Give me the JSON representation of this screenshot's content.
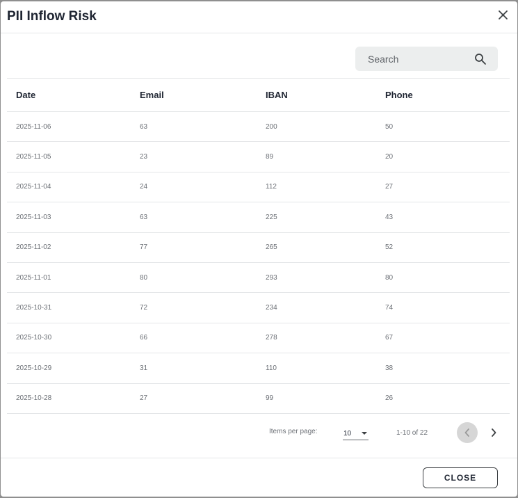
{
  "dialog": {
    "title": "PII Inflow Risk",
    "close_icon": "close-icon"
  },
  "search": {
    "placeholder": "Search",
    "value": "",
    "icon": "search-icon"
  },
  "table": {
    "columns": [
      "Date",
      "Email",
      "IBAN",
      "Phone"
    ],
    "rows": [
      [
        "2025-11-06",
        "63",
        "200",
        "50"
      ],
      [
        "2025-11-05",
        "23",
        "89",
        "20"
      ],
      [
        "2025-11-04",
        "24",
        "112",
        "27"
      ],
      [
        "2025-11-03",
        "63",
        "225",
        "43"
      ],
      [
        "2025-11-02",
        "77",
        "265",
        "52"
      ],
      [
        "2025-11-01",
        "80",
        "293",
        "80"
      ],
      [
        "2025-10-31",
        "72",
        "234",
        "74"
      ],
      [
        "2025-10-30",
        "66",
        "278",
        "67"
      ],
      [
        "2025-10-29",
        "31",
        "110",
        "38"
      ],
      [
        "2025-10-28",
        "27",
        "99",
        "26"
      ]
    ]
  },
  "paginator": {
    "items_per_page_label": "Items per page:",
    "items_per_page_value": "10",
    "range_label": "1-10 of 22",
    "prev_icon": "chevron-left-icon",
    "next_icon": "chevron-right-icon"
  },
  "footer": {
    "close_label": "CLOSE"
  }
}
